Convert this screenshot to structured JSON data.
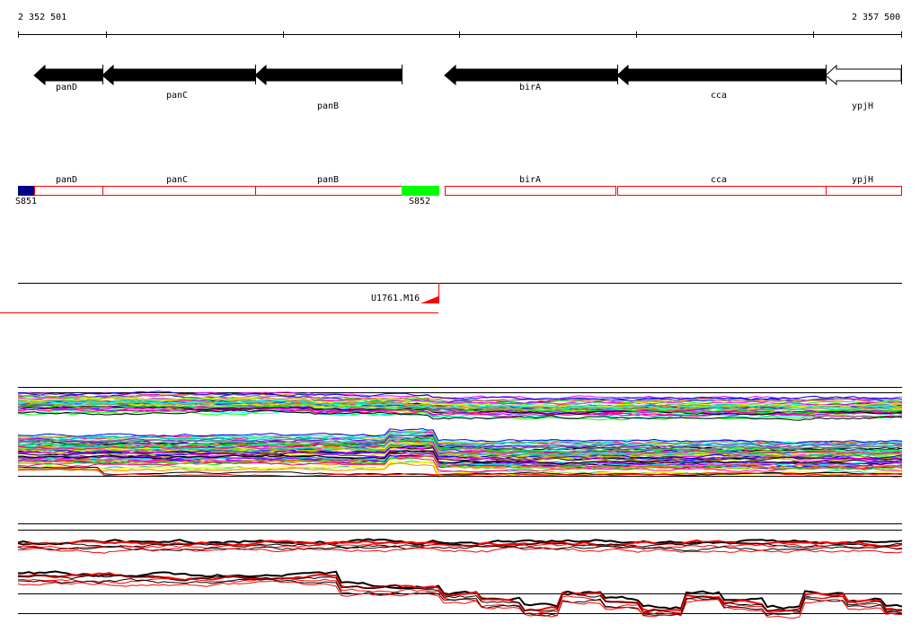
{
  "scale": {
    "start_label": "2 352 501",
    "end_label": "2 357 500"
  },
  "genes": [
    {
      "name": "panD",
      "strand": "-",
      "fill": "#000000"
    },
    {
      "name": "panC",
      "strand": "-",
      "fill": "#000000"
    },
    {
      "name": "panB",
      "strand": "-",
      "fill": "#000000"
    },
    {
      "name": "birA",
      "strand": "-",
      "fill": "#000000"
    },
    {
      "name": "cca",
      "strand": "-",
      "fill": "#000000"
    },
    {
      "name": "ypjH",
      "strand": "-",
      "fill": "#ffffff"
    }
  ],
  "segments": [
    {
      "name": "S851",
      "color": "#00008b"
    },
    {
      "name": "S852",
      "color": "#00ff00"
    }
  ],
  "feature_track": {
    "label": "U1761.M16",
    "color": "#ff0000"
  },
  "colors": {
    "box_outline": "#ff0000",
    "trace_highlight": "#ff0000"
  }
}
